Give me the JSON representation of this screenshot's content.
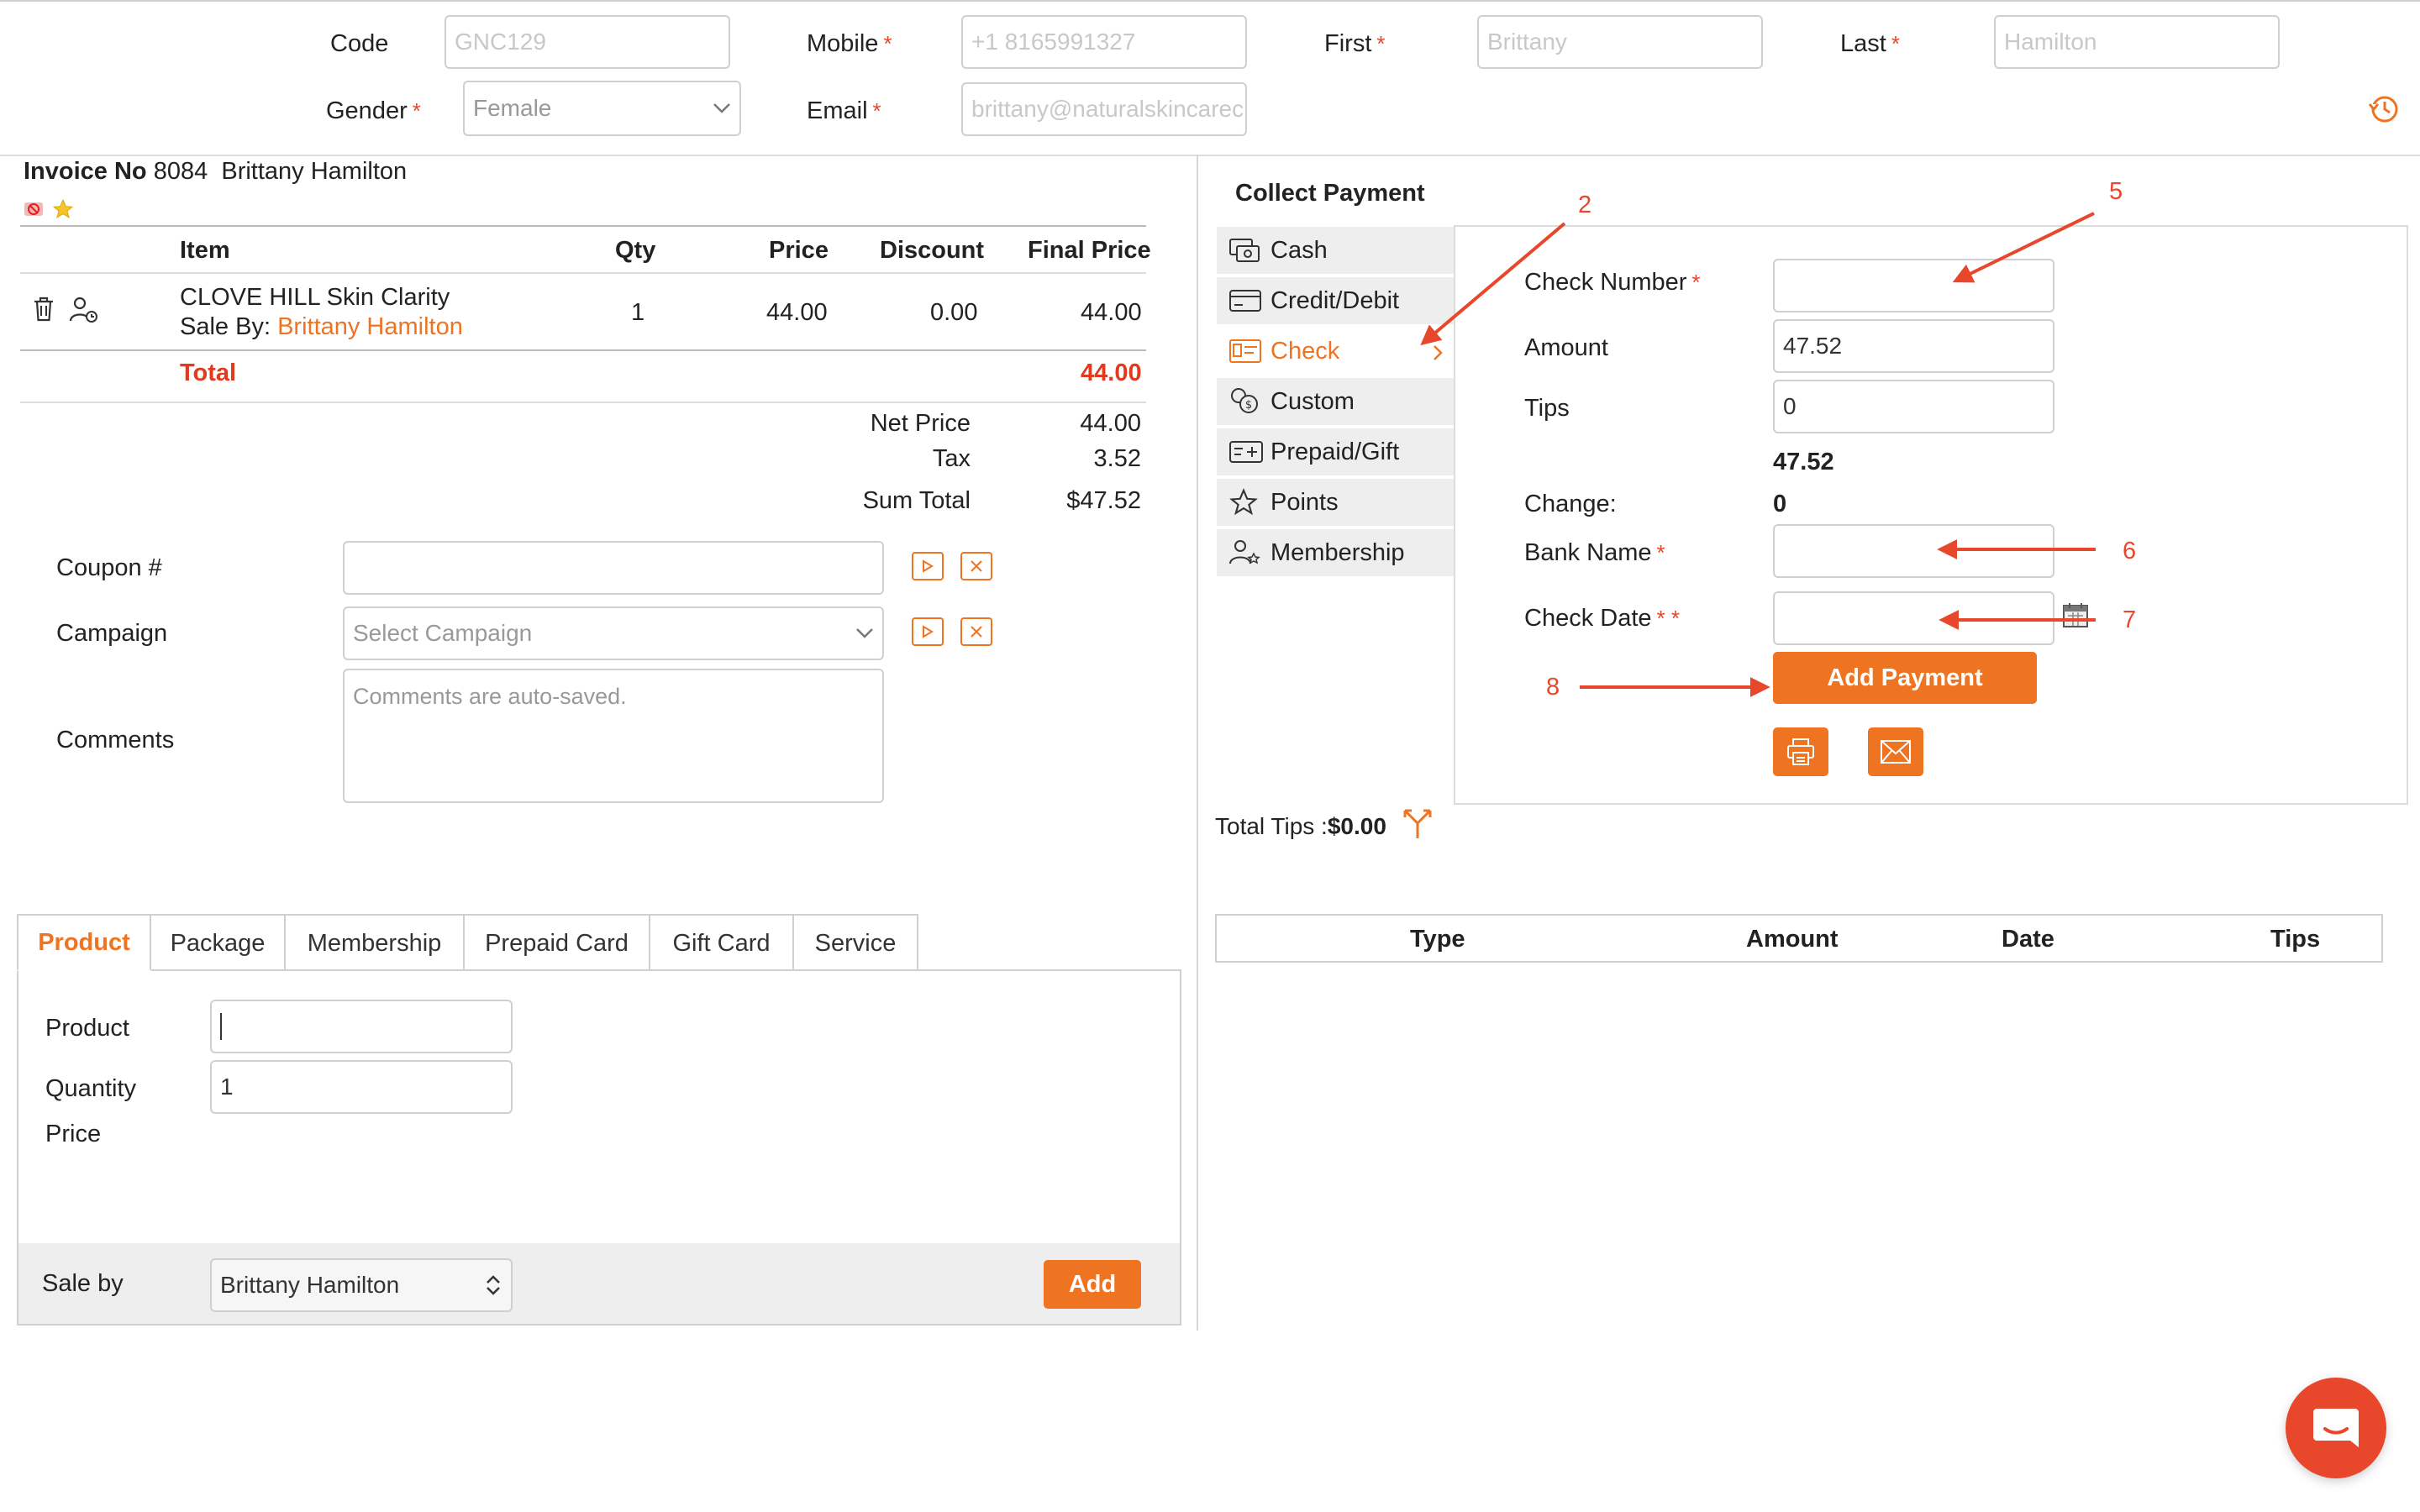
{
  "header": {
    "code_label": "Code",
    "code_value": "GNC129",
    "mobile_label": "Mobile",
    "mobile_value": "+1 8165991327",
    "first_label": "First",
    "first_value": "Brittany",
    "last_label": "Last",
    "last_value": "Hamilton",
    "gender_label": "Gender",
    "gender_value": "Female",
    "email_label": "Email",
    "email_value": "brittany@naturalskincarec",
    "required_mark": "*"
  },
  "invoice": {
    "label": "Invoice No",
    "number": "8084",
    "customer": "Brittany Hamilton"
  },
  "items_table": {
    "headers": {
      "item": "Item",
      "qty": "Qty",
      "price": "Price",
      "discount": "Discount",
      "final_price": "Final Price"
    },
    "rows": [
      {
        "name": "CLOVE HILL Skin Clarity",
        "sale_by_label": "Sale By:",
        "sale_by": "Brittany Hamilton",
        "qty": "1",
        "price": "44.00",
        "discount": "0.00",
        "final_price": "44.00"
      }
    ],
    "total_label": "Total",
    "total_value": "44.00"
  },
  "summary": {
    "net_price_label": "Net Price",
    "net_price": "44.00",
    "tax_label": "Tax",
    "tax": "3.52",
    "sum_total_label": "Sum Total",
    "sum_total": "$47.52"
  },
  "extras": {
    "coupon_label": "Coupon #",
    "campaign_label": "Campaign",
    "campaign_placeholder": "Select Campaign",
    "comments_label": "Comments",
    "comments_placeholder": "Comments are auto-saved."
  },
  "tabs": [
    "Product",
    "Package",
    "Membership",
    "Prepaid Card",
    "Gift Card",
    "Service"
  ],
  "product_form": {
    "product_label": "Product",
    "quantity_label": "Quantity",
    "quantity_value": "1",
    "price_label": "Price",
    "sale_by_label": "Sale by",
    "sale_by_value": "Brittany Hamilton",
    "add_label": "Add"
  },
  "collect_payment": {
    "title": "Collect Payment",
    "methods": [
      {
        "label": "Cash",
        "icon": "cash-icon"
      },
      {
        "label": "Credit/Debit",
        "icon": "card-icon"
      },
      {
        "label": "Check",
        "icon": "check-icon"
      },
      {
        "label": "Custom",
        "icon": "coins-icon"
      },
      {
        "label": "Prepaid/Gift",
        "icon": "gift-card-icon"
      },
      {
        "label": "Points",
        "icon": "star-icon"
      },
      {
        "label": "Membership",
        "icon": "members-icon"
      }
    ],
    "check_number_label": "Check Number",
    "amount_label": "Amount",
    "amount_value": "47.52",
    "tips_label": "Tips",
    "tips_value": "0",
    "computed_total": "47.52",
    "change_label": "Change:",
    "change_value": "0",
    "bank_name_label": "Bank Name",
    "check_date_label": "Check Date",
    "check_date_req": "* *",
    "add_payment_label": "Add Payment",
    "total_tips_label": "Total Tips :",
    "total_tips_value": "$0.00"
  },
  "payments_table": {
    "headers": {
      "type": "Type",
      "amount": "Amount",
      "date": "Date",
      "tips": "Tips"
    }
  },
  "annotations": [
    "2",
    "5",
    "6",
    "7",
    "8"
  ],
  "colors": {
    "accent": "#ef7422",
    "required": "#e8472c",
    "annotation": "#e8472c"
  }
}
